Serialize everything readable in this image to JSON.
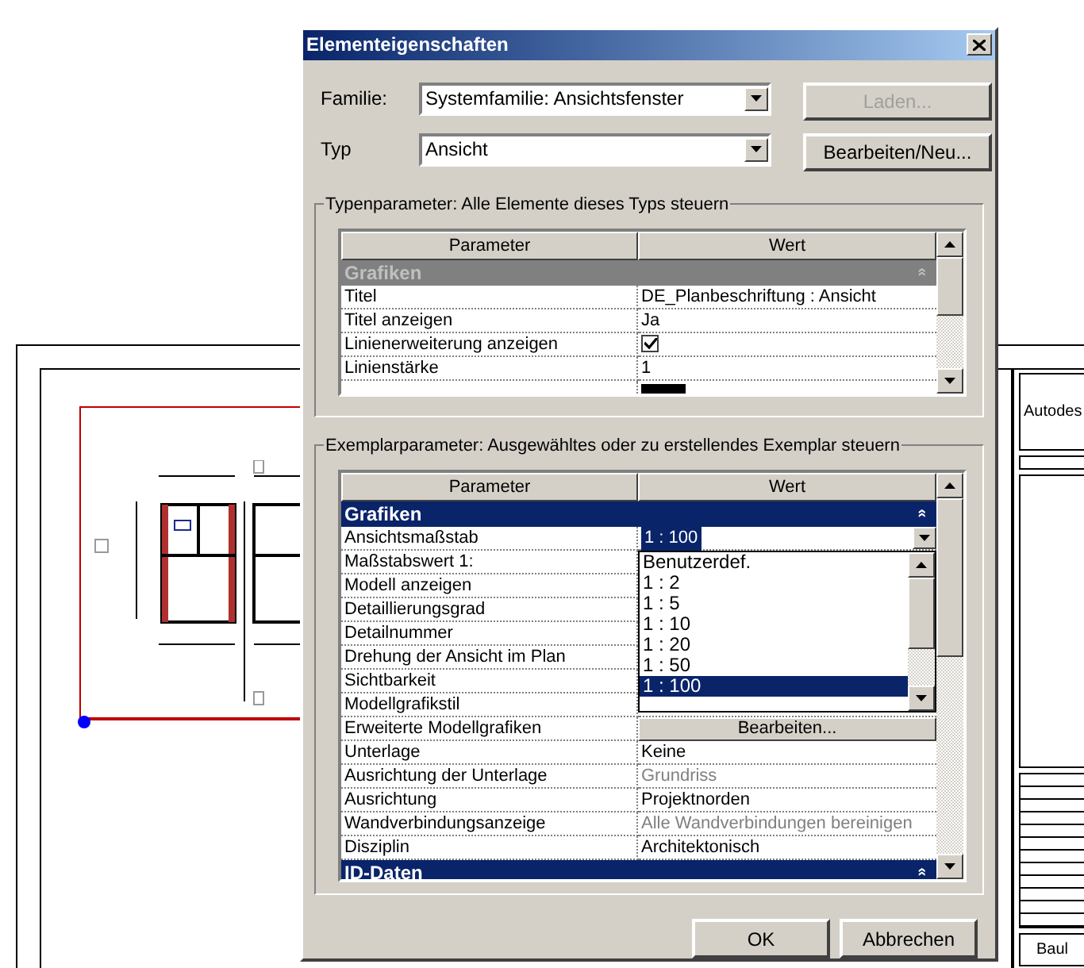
{
  "window": {
    "title": "Elementeigenschaften"
  },
  "familie": {
    "label": "Familie:",
    "value": "Systemfamilie: Ansichtsfenster"
  },
  "typ": {
    "label": "Typ",
    "value": "Ansicht"
  },
  "side_buttons": [
    {
      "label": "Laden...",
      "disabled": true
    },
    {
      "label": "Bearbeiten/Neu...",
      "disabled": false
    }
  ],
  "type_parameters": {
    "title": "Typenparameter: Alle Elemente dieses Typs steuern",
    "columns": [
      "Parameter",
      "Wert"
    ],
    "group": {
      "label": "Grafiken",
      "selected": false,
      "symbol": "»"
    },
    "rows": [
      {
        "kind": "text",
        "name": "Titel",
        "value": "DE_Planbeschriftung : Ansicht",
        "disabled": false
      },
      {
        "kind": "text",
        "name": "Titel anzeigen",
        "value": "Ja",
        "disabled": false
      },
      {
        "kind": "checkbox",
        "name": "Linienerweiterung anzeigen",
        "checked": true
      },
      {
        "kind": "text",
        "name": "Linienstärke",
        "value": "1",
        "disabled": false
      }
    ]
  },
  "instance_parameters": {
    "title": "Exemplarparameter: Ausgewähltes oder zu erstellendes Exemplar steuern",
    "columns": [
      "Parameter",
      "Wert"
    ],
    "group": {
      "label": "Grafiken",
      "selected": true,
      "symbol": "»"
    },
    "rows": [
      {
        "kind": "combo",
        "name": "Ansichtsmaßstab",
        "value": "1 : 100"
      },
      {
        "kind": "text",
        "name": "Maßstabswert 1:"
      },
      {
        "kind": "text",
        "name": "Modell anzeigen"
      },
      {
        "kind": "text",
        "name": "Detaillierungsgrad"
      },
      {
        "kind": "text",
        "name": "Detailnummer"
      },
      {
        "kind": "text",
        "name": "Drehung der Ansicht im Plan"
      },
      {
        "kind": "text",
        "name": "Sichtbarkeit"
      },
      {
        "kind": "text",
        "name": "Modellgrafikstil"
      },
      {
        "kind": "button",
        "name": "Erweiterte Modellgrafiken",
        "value": "Bearbeiten..."
      },
      {
        "kind": "text",
        "name": "Unterlage",
        "value": "Keine",
        "disabled": false
      },
      {
        "kind": "text",
        "name": "Ausrichtung der Unterlage",
        "value": "Grundriss",
        "disabled": true
      },
      {
        "kind": "text",
        "name": "Ausrichtung",
        "value": "Projektnorden",
        "disabled": false
      },
      {
        "kind": "text",
        "name": "Wandverbindungsanzeige",
        "value": "Alle Wandverbindungen bereinigen",
        "disabled": true
      },
      {
        "kind": "text",
        "name": "Disziplin",
        "value": "Architektonisch",
        "disabled": false
      }
    ],
    "next_group": {
      "label": "ID-Daten",
      "selected": true,
      "symbol": "»"
    }
  },
  "dropdown": {
    "items": [
      {
        "label": "Benutzerdef.",
        "selected": false
      },
      {
        "label": "1 : 2",
        "selected": false
      },
      {
        "label": "1 : 5",
        "selected": false
      },
      {
        "label": "1 : 10",
        "selected": false
      },
      {
        "label": "1 : 20",
        "selected": false
      },
      {
        "label": "1 : 50",
        "selected": false
      },
      {
        "label": "1 : 100",
        "selected": true
      }
    ]
  },
  "buttons": [
    "OK",
    "Abbrechen"
  ],
  "sheet": {
    "title_block": [
      "Autodes",
      "Baul"
    ]
  }
}
